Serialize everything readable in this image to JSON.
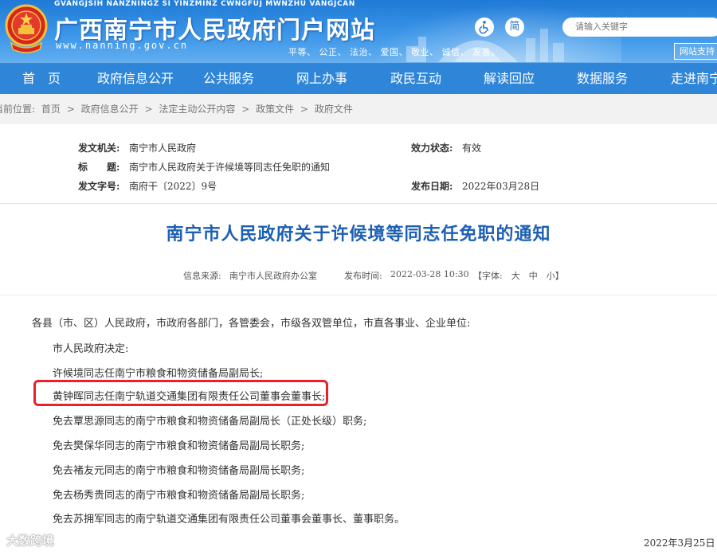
{
  "header": {
    "pinyin": "GVANGJSIH NANZNINGZ SI YINZMINZ CWNGFUJ MWNZHU VANGJCAN",
    "title": "广西南宁市人民政府门户网站",
    "url": "www.nanning.gov.cn",
    "motto": "平等、 公正、 法治、 爱国、 敬业、 诚信、 友善。",
    "simplified_label": "简",
    "accessibility_icon": "wheelchair-icon",
    "search_placeholder": "请输入关键字",
    "support_label": "网站支持"
  },
  "nav": {
    "items": [
      "首　页",
      "政府信息公开",
      "公共服务",
      "网上办事",
      "政民互动",
      "解读回应",
      "数据服务",
      "走进南宁"
    ]
  },
  "breadcrumb": {
    "prefix": "当前位置:",
    "items": [
      "首页",
      "政府信息公开",
      "法定主动公开内容",
      "政策文件",
      "政府文件"
    ],
    "separator": ">"
  },
  "meta": {
    "issuer_label": "发文机关:",
    "issuer": "南宁市人民政府",
    "validity_label": "效力状态:",
    "validity": "有效",
    "title_label": "标　　题:",
    "title": "南宁市人民政府关于许候境等同志任免职的通知",
    "doc_no_label": "发文字号:",
    "doc_no": "南府干〔2022〕9号",
    "date_label": "发布日期:",
    "date": "2022年03月28日"
  },
  "article": {
    "title": "南宁市人民政府关于许候境等同志任免职的通知",
    "source_label": "信息来源:",
    "source": "南宁市人民政府办公室",
    "time_label": "发布时间:",
    "time": "2022-03-28 10:30",
    "font_size_control": "【字体:　大　中　小】",
    "paragraphs": [
      "各县（市、区）人民政府，市政府各部门，各管委会，市级各双管单位，市直各事业、企业单位:",
      "市人民政府决定:",
      "许候境同志任南宁市粮食和物资储备局副局长;",
      "黄钟晖同志任南宁轨道交通集团有限责任公司董事会董事长;",
      "免去覃思源同志的南宁市粮食和物资储备局副局长（正处长级）职务;",
      "免去樊保华同志的南宁市粮食和物资储备局副局长职务;",
      "免去褚友元同志的南宁市粮食和物资储备局副局长职务;",
      "免去杨秀贵同志的南宁市粮食和物资储备局副局长职务;",
      "免去苏拥军同志的南宁轨道交通集团有限责任公司董事会董事长、董事职务。"
    ],
    "sign_date": "2022年3月25日",
    "highlight_color": "#e8212a",
    "title_color": "#1c5fb4"
  },
  "watermark": "大数跨境"
}
